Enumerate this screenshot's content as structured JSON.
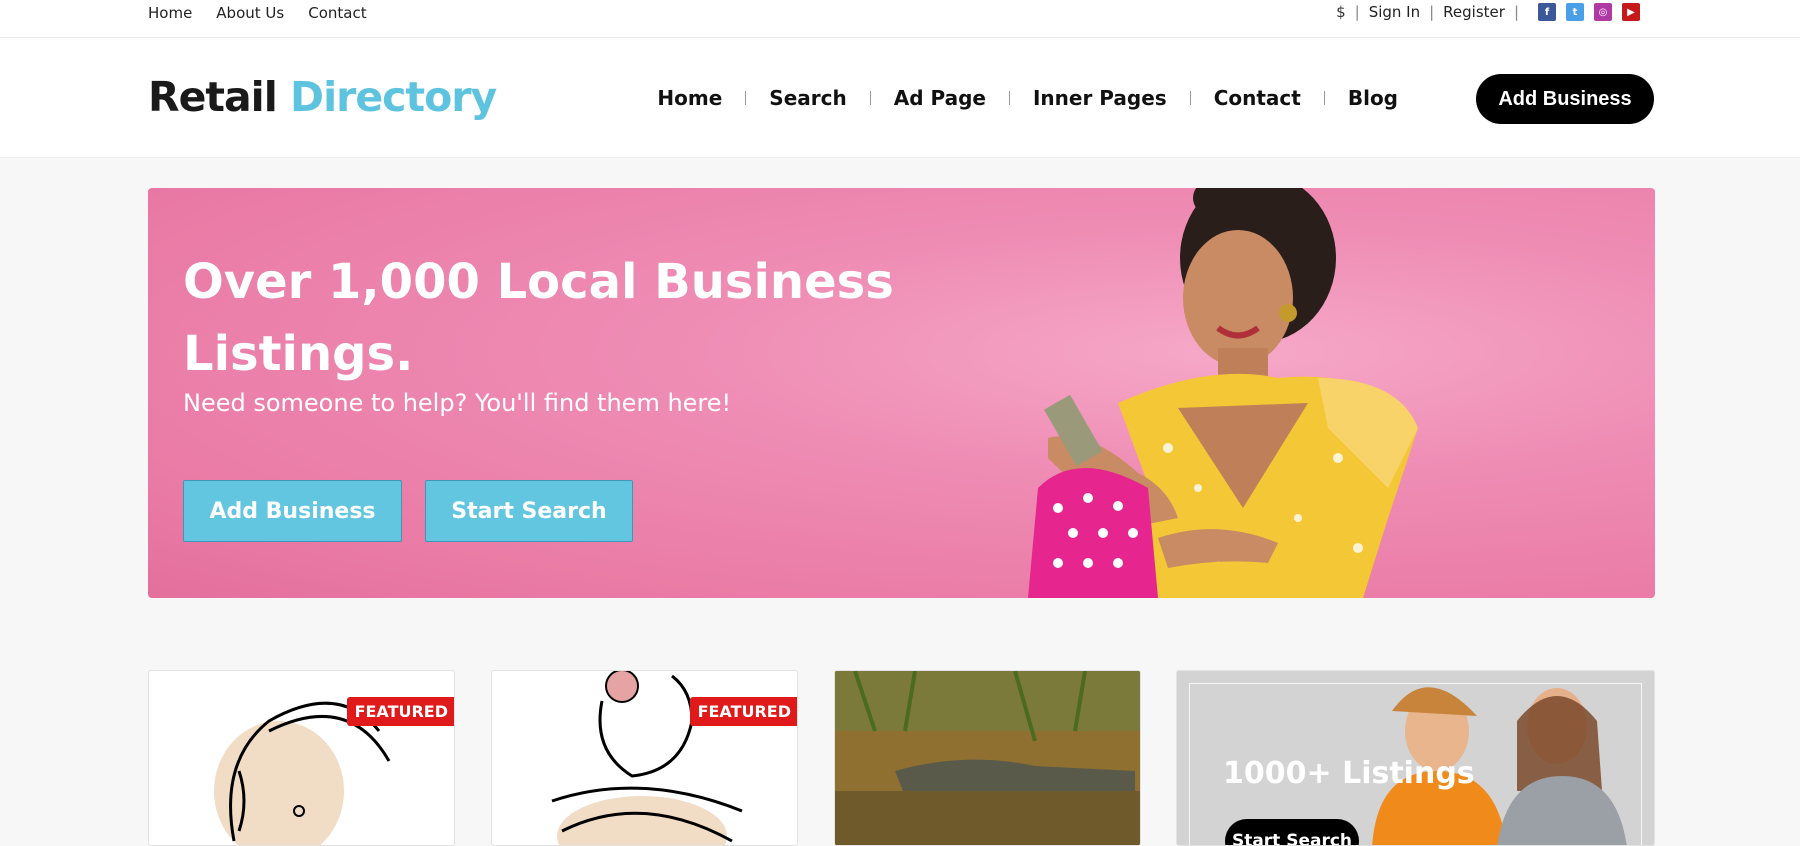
{
  "topbar": {
    "links": [
      "Home",
      "About Us",
      "Contact"
    ],
    "currency": "$",
    "sign_in": "Sign In",
    "register": "Register",
    "social": [
      {
        "name": "facebook-icon",
        "color": "#3b5998",
        "glyph": "f"
      },
      {
        "name": "twitter-icon",
        "color": "#4a9fe6",
        "glyph": "t"
      },
      {
        "name": "instagram-icon",
        "color": "#b03aa5",
        "glyph": "◎"
      },
      {
        "name": "youtube-icon",
        "color": "#c4181b",
        "glyph": "▶"
      }
    ]
  },
  "header": {
    "logo_part1": "Retail",
    "logo_part2": "Directory",
    "nav": [
      "Home",
      "Search",
      "Ad Page",
      "Inner Pages",
      "Contact",
      "Blog"
    ],
    "cta": "Add Business"
  },
  "hero": {
    "title": "Over 1,000 Local Business Listings.",
    "subtitle": "Need someone to help? You'll find them here!",
    "btn_add": "Add Business",
    "btn_search": "Start Search"
  },
  "cards": {
    "featured_1": "FEATURED",
    "featured_2": "FEATURED",
    "promo_title": "1000+ Listings",
    "promo_button": "Start Search"
  },
  "colors": {
    "accent": "#5ec3de",
    "hero_pink": "#ef8db5",
    "badge_red": "#e01a1a"
  }
}
